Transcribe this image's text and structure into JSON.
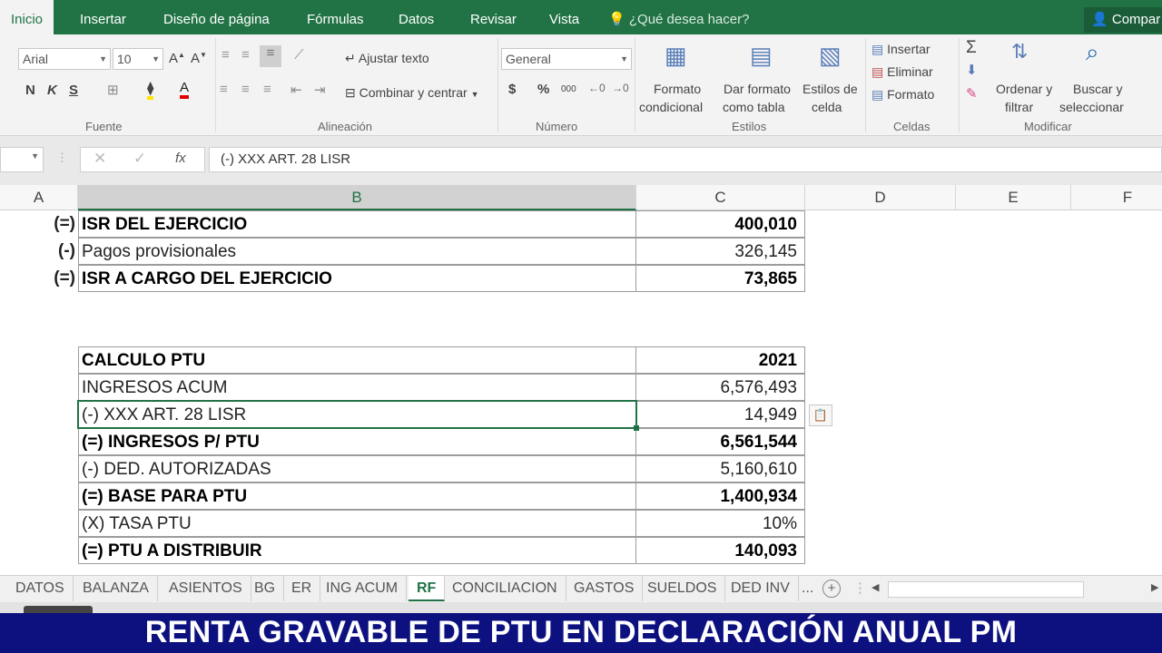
{
  "ribbon_tabs": [
    "Inicio",
    "Insertar",
    "Diseño de página",
    "Fórmulas",
    "Datos",
    "Revisar",
    "Vista"
  ],
  "tell_me": "¿Qué desea hacer?",
  "share_label": "Compar",
  "ribbon": {
    "font_name": "Arial",
    "font_size": "10",
    "bold": "N",
    "italic": "K",
    "underline": "S",
    "wrap_text": "Ajustar texto",
    "merge_center": "Combinar y centrar",
    "number_format": "General",
    "currency": "$",
    "percent": "%",
    "thousands": "000",
    "cond_format_1": "Formato",
    "cond_format_2": "condicional",
    "format_table_1": "Dar formato",
    "format_table_2": "como tabla",
    "cell_styles_1": "Estilos de",
    "cell_styles_2": "celda",
    "insert": "Insertar",
    "delete": "Eliminar",
    "format": "Formato",
    "sort_1": "Ordenar y",
    "sort_2": "filtrar",
    "find_1": "Buscar y",
    "find_2": "seleccionar",
    "groups": {
      "fuente": "Fuente",
      "alineacion": "Alineación",
      "numero": "Número",
      "estilos": "Estilos",
      "celdas": "Celdas",
      "modificar": "Modificar"
    }
  },
  "formula_bar": {
    "content": "(-) XXX ART. 28 LISR"
  },
  "columns": [
    "A",
    "B",
    "C",
    "D",
    "E",
    "F"
  ],
  "table1": [
    {
      "prefix": "(=)",
      "label": "ISR DEL EJERCICIO",
      "value": "400,010",
      "bold": true
    },
    {
      "prefix": "(-)",
      "label": "Pagos provisionales",
      "value": "326,145",
      "bold": false
    },
    {
      "prefix": "(=)",
      "label": "ISR A CARGO DEL EJERCICIO",
      "value": "73,865",
      "bold": true
    }
  ],
  "table2": [
    {
      "label": "CALCULO PTU",
      "value": "2021",
      "bold": true
    },
    {
      "label": "INGRESOS ACUM",
      "value": "6,576,493",
      "bold": false
    },
    {
      "label": "(-) XXX ART. 28 LISR",
      "value": "14,949",
      "bold": false
    },
    {
      "label": "(=) INGRESOS P/ PTU",
      "value": "6,561,544",
      "bold": true
    },
    {
      "label": "(-) DED. AUTORIZADAS",
      "value": "5,160,610",
      "bold": false
    },
    {
      "label": "(=) BASE PARA PTU",
      "value": "1,400,934",
      "bold": true
    },
    {
      "label": "(X) TASA PTU",
      "value": "10%",
      "bold": false
    },
    {
      "label": "(=) PTU A DISTRIBUIR",
      "value": "140,093",
      "bold": true
    }
  ],
  "sheet_tabs": [
    "DATOS",
    "BALANZA",
    "ASIENTOS",
    "BG",
    "ER",
    "ING ACUM",
    "RF",
    "CONCILIACION",
    "GASTOS",
    "SUELDOS",
    "DED INV",
    "..."
  ],
  "active_sheet": "RF",
  "banner": "RENTA GRAVABLE DE PTU EN DECLARACIÓN ANUAL PM",
  "colors": {
    "excel_green": "#217346",
    "banner_blue": "#0d1180"
  }
}
